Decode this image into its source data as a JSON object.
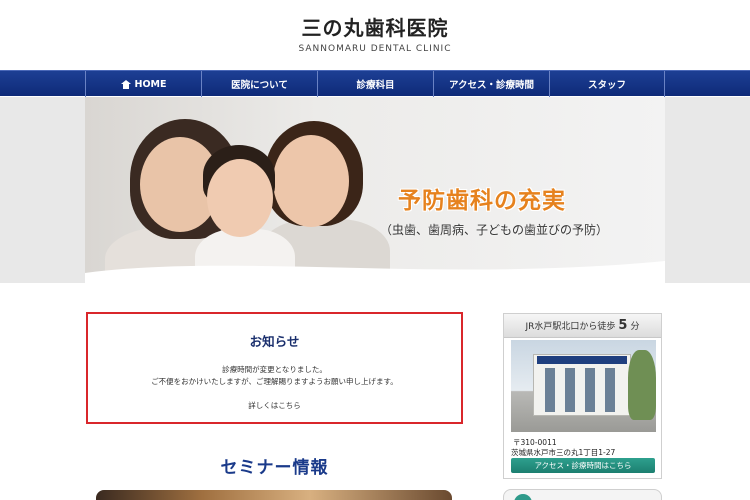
{
  "header": {
    "title": "三の丸歯科医院",
    "subtitle": "SANNOMARU DENTAL CLINIC"
  },
  "nav": {
    "items": [
      {
        "label": "HOME",
        "icon": "home-icon"
      },
      {
        "label": "医院について"
      },
      {
        "label": "診療科目"
      },
      {
        "label": "アクセス・診療時間"
      },
      {
        "label": "スタッフ"
      }
    ]
  },
  "hero": {
    "headline": "予防歯科の充実",
    "subline": "（虫歯、歯周病、子どもの歯並びの予防）"
  },
  "notice": {
    "title": "お知らせ",
    "lines": [
      "診療時間が変更となりました。",
      "ご不便をおかけいたしますが、ご理解賜りますようお願い申し上げます。"
    ],
    "link": "詳しくはこちら"
  },
  "seminar": {
    "title": "セミナー情報"
  },
  "sidebar": {
    "station": "JR水戸駅北口から徒歩",
    "minutes": "5",
    "minutes_unit": "分",
    "zip": "〒310-0011",
    "address": "茨城県水戸市三の丸1丁目1-27",
    "access_button": "アクセス・診療時間はこちら"
  },
  "colors": {
    "nav_bg": "#15368a",
    "notice_border": "#d9262b",
    "heading_blue": "#1a3a8a",
    "hero_accent": "#e6821e",
    "access_button": "#1c7f70"
  }
}
